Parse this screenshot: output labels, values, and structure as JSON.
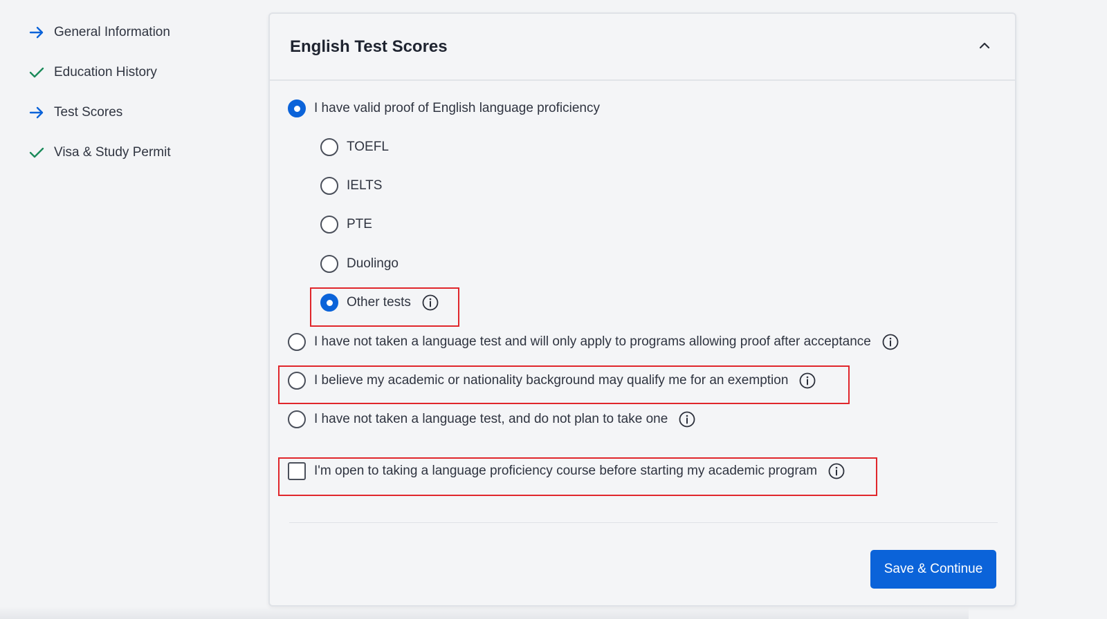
{
  "sidebar": {
    "items": [
      {
        "label": "General Information",
        "icon": "arrow-right-icon",
        "status": "arrow"
      },
      {
        "label": "Education History",
        "icon": "checkmark-icon",
        "status": "complete"
      },
      {
        "label": "Test Scores",
        "icon": "arrow-right-icon",
        "status": "arrow"
      },
      {
        "label": "Visa & Study Permit",
        "icon": "checkmark-icon",
        "status": "complete"
      }
    ]
  },
  "card": {
    "title": "English Test Scores",
    "collapse_icon": "chevron-up-icon"
  },
  "options": {
    "valid_proof": "I have valid proof of English language proficiency",
    "tests": {
      "toefl": "TOEFL",
      "ielts": "IELTS",
      "pte": "PTE",
      "duolingo": "Duolingo",
      "other": "Other tests"
    },
    "not_taken_proof_after": "I have not taken a language test and will only apply to programs allowing proof after acceptance",
    "exemption": "I believe my academic or nationality background may qualify me for an exemption",
    "no_plan": "I have not taken a language test, and do not plan to take one",
    "open_course": "I'm open to taking a language proficiency course before starting my academic program"
  },
  "selected": {
    "main": "valid_proof",
    "test": "other",
    "open_course_checked": false
  },
  "actions": {
    "save_label": "Save & Continue"
  },
  "colors": {
    "accent": "#0b63d9",
    "check": "#1a8a5a",
    "highlight": "#e0262b"
  }
}
